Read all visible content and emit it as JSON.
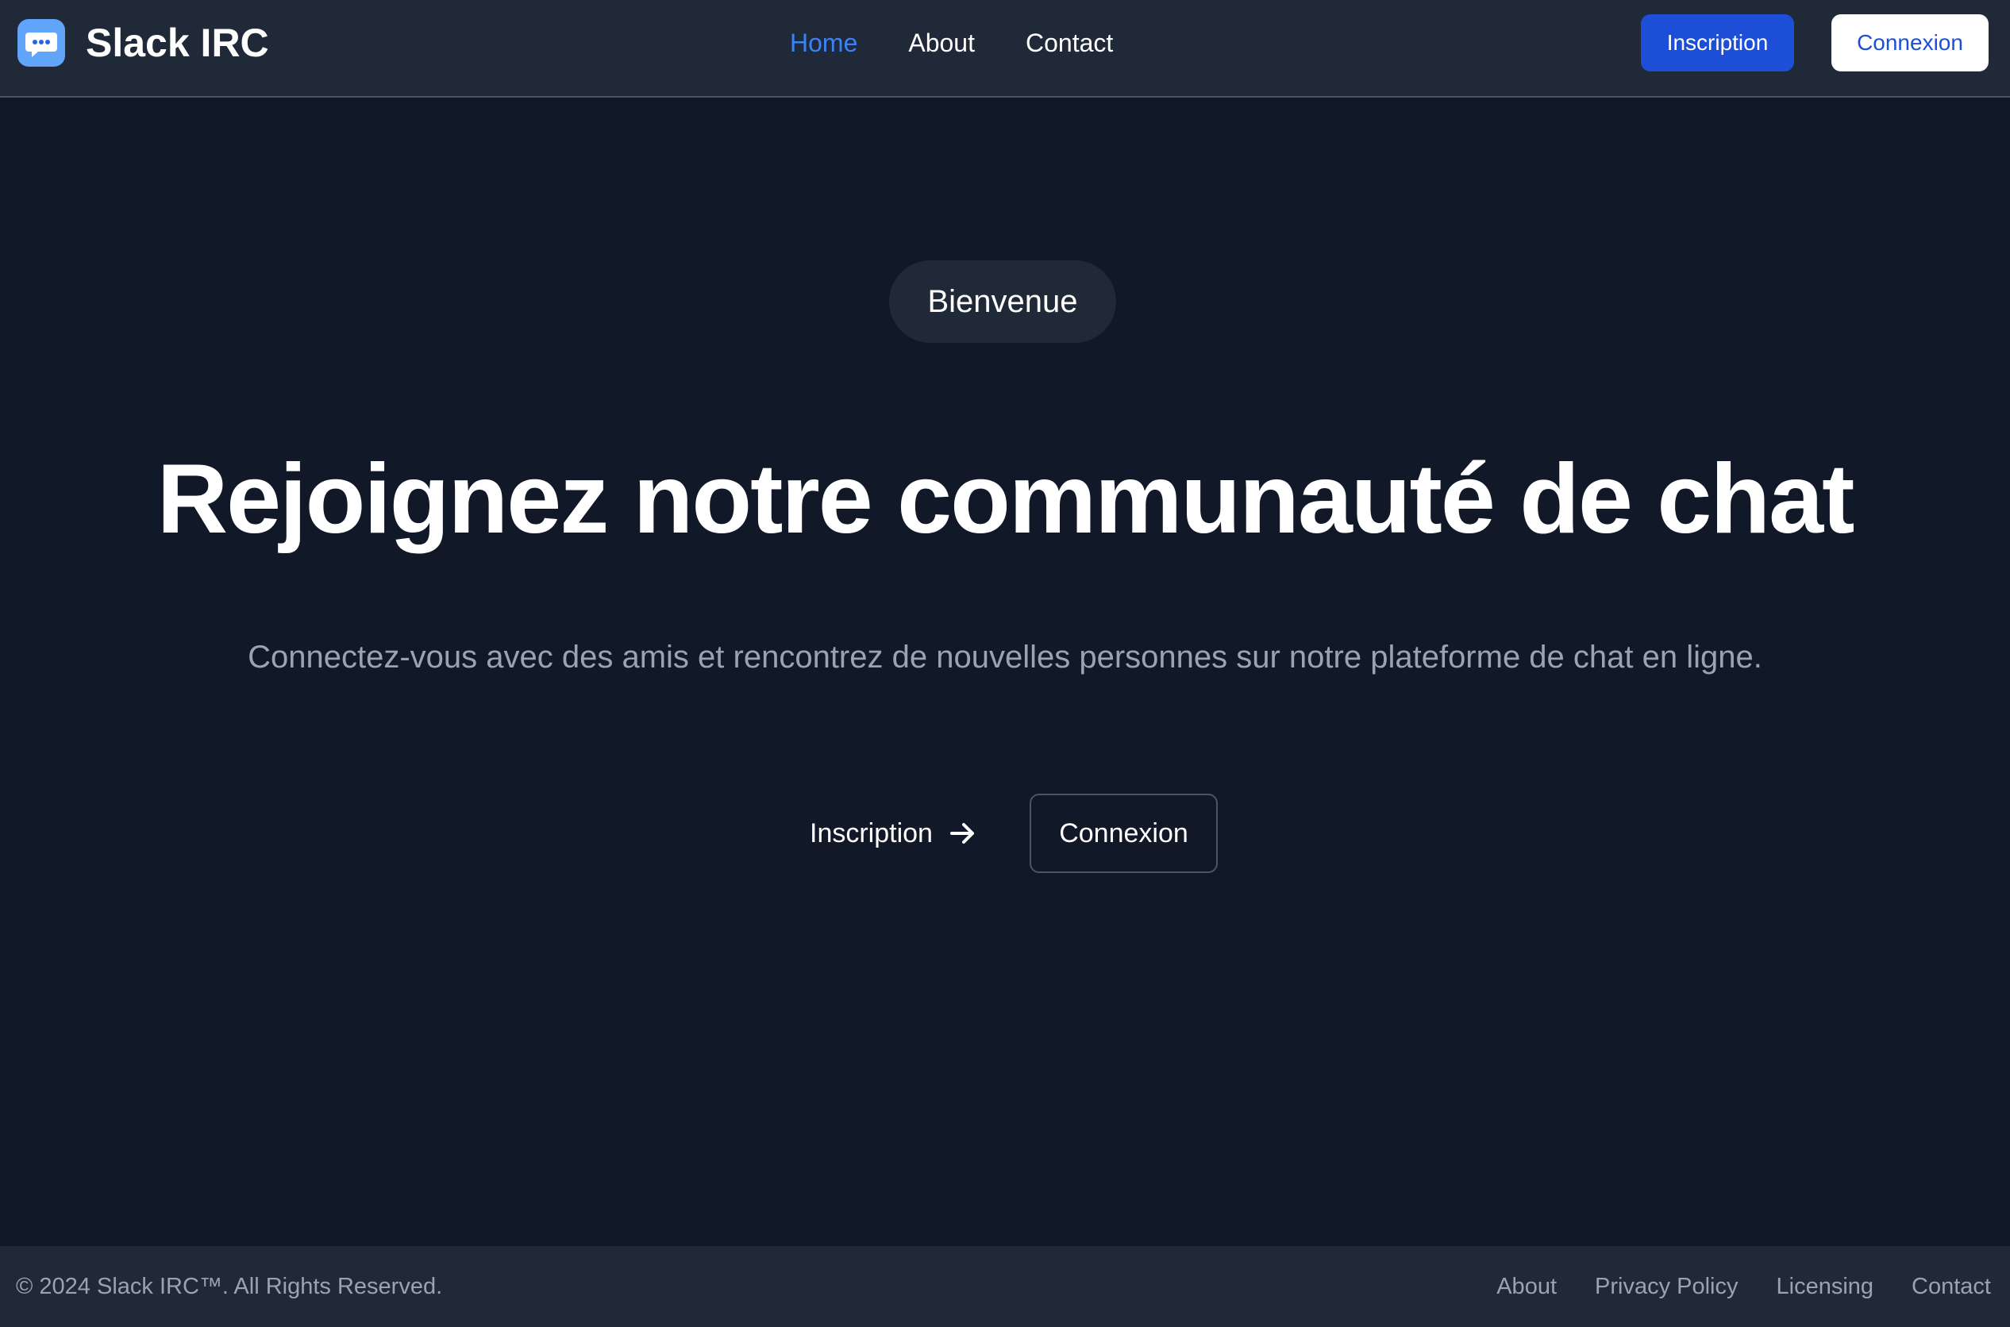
{
  "brand": {
    "name": "Slack IRC",
    "icon": "chat-bubble-icon",
    "icon_color": "#60a5fa"
  },
  "nav": {
    "items": [
      {
        "label": "Home",
        "active": true
      },
      {
        "label": "About",
        "active": false
      },
      {
        "label": "Contact",
        "active": false
      }
    ]
  },
  "header_actions": {
    "signup_label": "Inscription",
    "login_label": "Connexion"
  },
  "hero": {
    "badge": "Bienvenue",
    "title": "Rejoignez notre communauté de chat",
    "subtitle": "Connectez-vous avec des amis et rencontrez de nouvelles personnes sur notre plateforme de chat en ligne.",
    "primary_cta": "Inscription",
    "primary_cta_icon": "arrow-right-icon",
    "secondary_cta": "Connexion"
  },
  "footer": {
    "copyright": "© 2024 Slack IRC™. All Rights Reserved.",
    "links": [
      "About",
      "Privacy Policy",
      "Licensing",
      "Contact"
    ]
  },
  "colors": {
    "background": "#111827",
    "surface": "#1f2937",
    "accent": "#1d4ed8",
    "active_link": "#3b82f6",
    "muted_text": "#9ca3af"
  }
}
